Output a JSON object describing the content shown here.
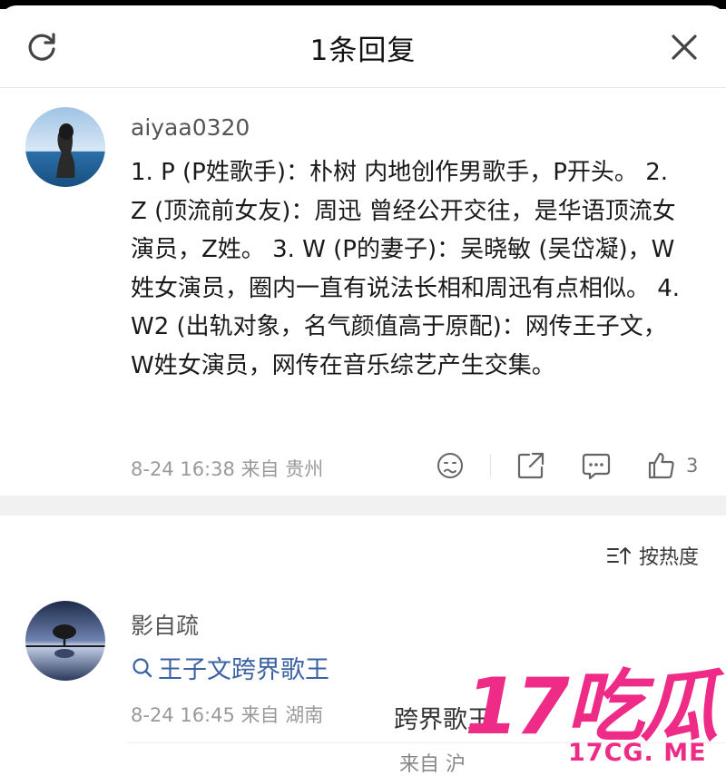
{
  "header": {
    "title": "1条回复"
  },
  "comment1": {
    "username": "aiyaa0320",
    "text": "1. P (P姓歌手)：朴树 内地创作男歌手，P开头。 2. Z (顶流前女友)：周迅 曾经公开交往，是华语顶流女演员，Z姓。 3. W (P的妻子)：吴晓敏 (吴岱凝)，W姓女演员，圈内一直有说法长相和周迅有点相似。 4. W2 (出轨对象，名气颜值高于原配)：网传王子文，W姓女演员，网传在音乐综艺产生交集。",
    "meta": "8-24 16:38  来自 贵州",
    "likes": "3"
  },
  "sort": {
    "label": "按热度"
  },
  "comment2": {
    "username": "影自疏",
    "search_text": "王子文跨界歌王",
    "meta": "8-24 16:45  来自 湖南",
    "overlay_a": "跨界歌王",
    "overlay_b": "来自 沪"
  },
  "watermark": {
    "main": "17吃瓜",
    "sub": "17CG. ME"
  },
  "colors": {
    "accent_link": "#3b63a3",
    "watermark": "#ee2b86"
  },
  "icons": [
    "refresh-icon",
    "close-icon",
    "dislike-icon",
    "share-icon",
    "reply-icon",
    "like-icon",
    "sort-icon",
    "search-icon"
  ]
}
